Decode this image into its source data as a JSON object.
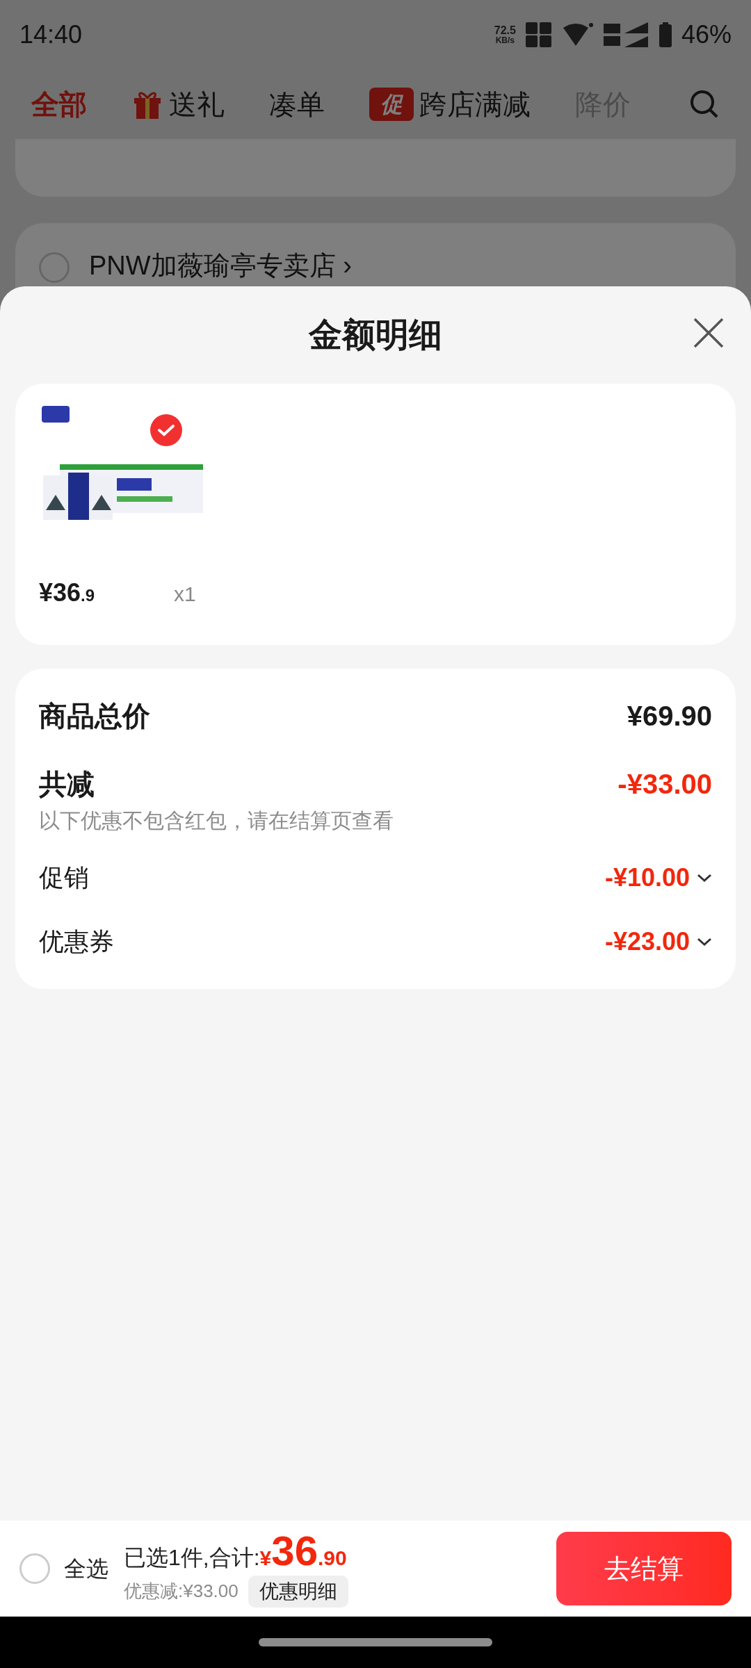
{
  "status_bar": {
    "time": "14:40",
    "net_speed": "72.5",
    "net_speed_unit": "KB/s",
    "battery": "46%"
  },
  "tabs": [
    {
      "label": "全部",
      "selected": true,
      "faded": false,
      "kind": "plain"
    },
    {
      "label": "送礼",
      "selected": false,
      "faded": false,
      "kind": "gift"
    },
    {
      "label": "凑单",
      "selected": false,
      "faded": false,
      "kind": "plain"
    },
    {
      "label": "跨店满减",
      "selected": false,
      "faded": false,
      "kind": "promo",
      "badge": "促"
    },
    {
      "label": "降价",
      "selected": false,
      "faded": true,
      "kind": "plain"
    }
  ],
  "stores": [
    {
      "name": "PNW加薇瑜亭专卖店 ›",
      "checked": false
    }
  ],
  "sheet": {
    "title": "金额明细",
    "item": {
      "selected": true,
      "price": "¥36",
      "price_decimal": ".9",
      "quantity": "x1"
    },
    "summary": {
      "total_label": "商品总价",
      "total": "¥69.90",
      "reduction_label": "共减",
      "reduction": "-¥33.00",
      "note": "以下优惠不包含红包，请在结算页查看",
      "details": [
        {
          "label": "促销",
          "amount": "-¥10.00"
        },
        {
          "label": "优惠券",
          "amount": "-¥23.00"
        }
      ]
    }
  },
  "bottom_bar": {
    "select_all": {
      "label": "全选",
      "checked": false
    },
    "selected_text": "已选1件,合计:",
    "currency": "¥",
    "total": "36",
    "total_decimal": ".90",
    "discount": "优惠减:¥33.00",
    "details_button": "优惠明细",
    "checkout": "去结算"
  }
}
